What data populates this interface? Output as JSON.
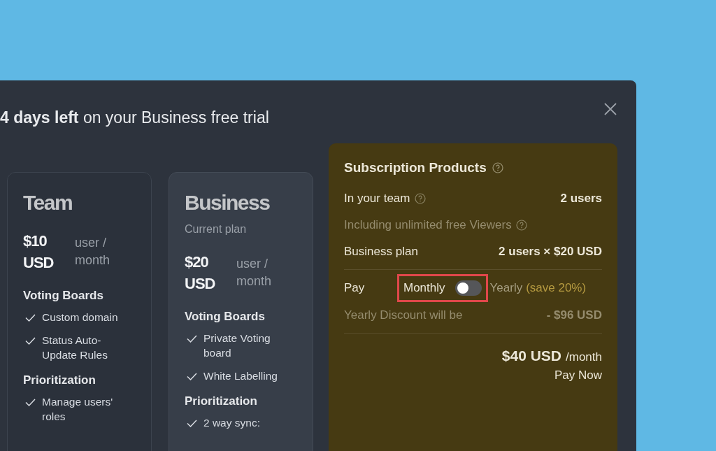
{
  "dialog": {
    "title": "**4 days left** on your Business free trial"
  },
  "plans": [
    {
      "name": "Team",
      "selected": false,
      "price": "$10 USD",
      "unit": "user / month",
      "sections": [
        {
          "title": "Voting Boards",
          "features": [
            "Custom domain",
            "Status Auto-Update Rules"
          ]
        },
        {
          "title": "Prioritization",
          "features": [
            "Manage users' roles"
          ]
        }
      ]
    },
    {
      "name": "Business",
      "selected": true,
      "note": "Current plan",
      "price": "$20 USD",
      "unit": "user / month",
      "sections": [
        {
          "title": "Voting Boards",
          "features": [
            "Private Voting board",
            "White Labelling"
          ]
        },
        {
          "title": "Prioritization",
          "features": [
            "2 way sync:"
          ]
        }
      ]
    }
  ],
  "summary": {
    "title": "Subscription Products",
    "rows": [
      {
        "label": "In your team",
        "value": "2 users",
        "help": true,
        "muted": false
      },
      {
        "label": "Including unlimited free Viewers",
        "help": true,
        "muted": true
      },
      {
        "label": "Business plan",
        "value": "2 users × $20 USD",
        "help": false,
        "muted": false
      }
    ],
    "pay": {
      "label": "Pay",
      "monthly": "Monthly",
      "yearly": "Yearly",
      "save": "(save 20%)",
      "on": false,
      "highlighted": true
    },
    "discount": {
      "label": "Yearly Discount will be",
      "value": "- $96 USD"
    },
    "total": {
      "amount": "$40 USD",
      "period": "/month",
      "action": "Pay Now"
    }
  }
}
